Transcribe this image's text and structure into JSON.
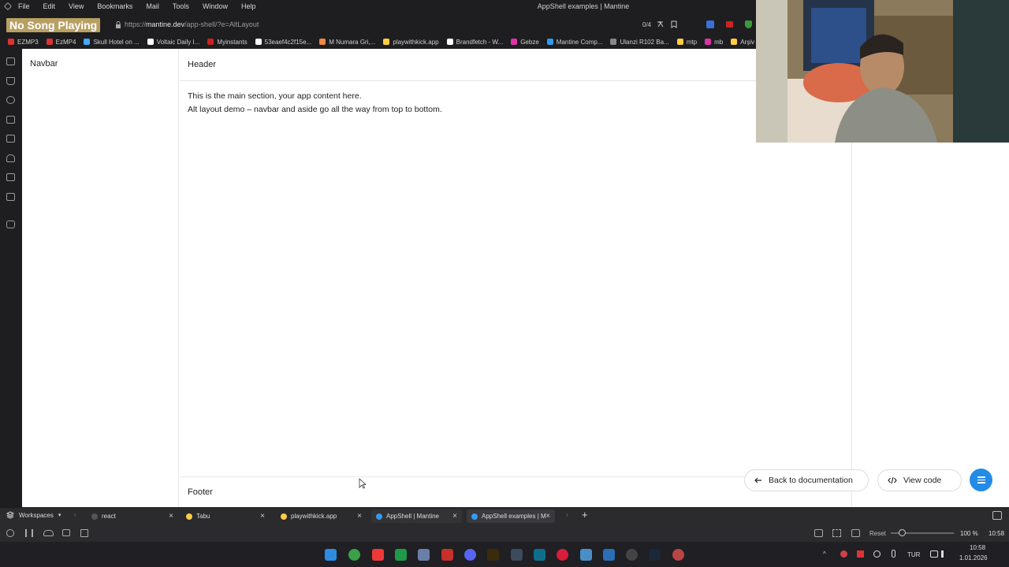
{
  "menubar": {
    "items": [
      "File",
      "Edit",
      "View",
      "Bookmarks",
      "Mail",
      "Tools",
      "Window",
      "Help"
    ],
    "window_title": "AppShell examples | Mantine"
  },
  "now_playing": "No Song Playing",
  "address": {
    "scheme": "https://",
    "host": "mantine.dev",
    "path": "/app-shell/?e=AltLayout",
    "counter": "0/4"
  },
  "bookmarks": [
    {
      "label": "EZMP3",
      "color": "#d33"
    },
    {
      "label": "EzMP4",
      "color": "#d33"
    },
    {
      "label": "Skull Hotel on ...",
      "color": "#4af"
    },
    {
      "label": "Voltaic Daily I...",
      "color": "#fff"
    },
    {
      "label": "Myinstants",
      "color": "#c22"
    },
    {
      "label": "53eaef4c2f15e...",
      "color": "#fff"
    },
    {
      "label": "M Numara Gri,...",
      "color": "#e84"
    },
    {
      "label": "playwithkick.app",
      "color": "#fc4"
    },
    {
      "label": "Brandfetch - W...",
      "color": "#fff"
    },
    {
      "label": "Gebze",
      "color": "#d3a"
    },
    {
      "label": "Mantine Comp...",
      "color": "#339af0"
    },
    {
      "label": "Ulanzi R102 Ba...",
      "color": "#888"
    },
    {
      "label": "mtp",
      "color": "#fc4"
    },
    {
      "label": "mb",
      "color": "#d3a"
    },
    {
      "label": "Arşiv",
      "color": "#fc4"
    }
  ],
  "app": {
    "navbar_label": "Navbar",
    "header_label": "Header",
    "main_line1": "This is the main section, your app content here.",
    "main_line2": "Alt layout demo – navbar and aside go all the way from top to bottom.",
    "footer_label": "Footer",
    "back_button": "Back to documentation",
    "view_code_button": "View code"
  },
  "tabbar": {
    "workspaces_label": "Workspaces",
    "tabs": [
      {
        "label": "react",
        "color": "#555"
      },
      {
        "label": "Tabu",
        "color": "#fc4"
      },
      {
        "label": "playwithkick.app",
        "color": "#fc4"
      },
      {
        "label": "AppShell | Mantine",
        "color": "#339af0"
      },
      {
        "label": "AppShell examples | M",
        "color": "#339af0"
      }
    ]
  },
  "statusbar": {
    "reset_label": "Reset",
    "zoom": "100 %",
    "zoom_level": 0.18,
    "time": "10:58"
  },
  "taskbar": {
    "language": "TUR",
    "time": "10:58",
    "date": "1.01.2026"
  },
  "colors": {
    "accent": "#228be6",
    "chrome_bg": "#1e1e20"
  }
}
